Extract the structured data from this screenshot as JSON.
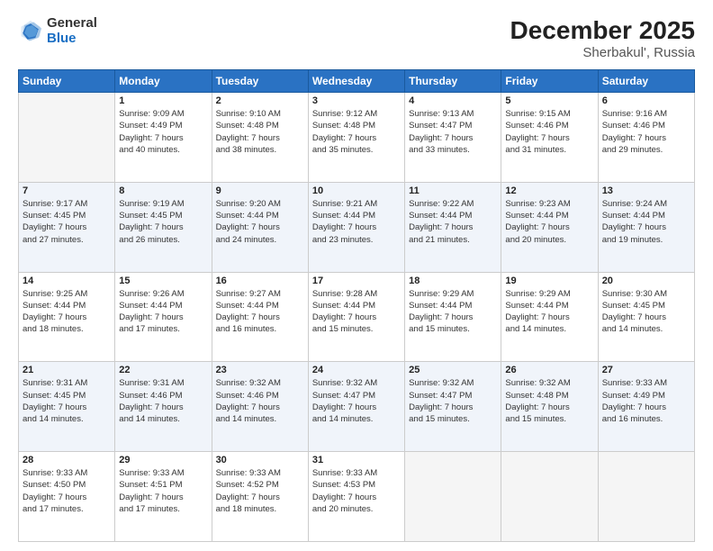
{
  "logo": {
    "general": "General",
    "blue": "Blue"
  },
  "title": {
    "month": "December 2025",
    "location": "Sherbakul', Russia"
  },
  "weekdays": [
    "Sunday",
    "Monday",
    "Tuesday",
    "Wednesday",
    "Thursday",
    "Friday",
    "Saturday"
  ],
  "weeks": [
    [
      {
        "day": "",
        "info": ""
      },
      {
        "day": "1",
        "info": "Sunrise: 9:09 AM\nSunset: 4:49 PM\nDaylight: 7 hours\nand 40 minutes."
      },
      {
        "day": "2",
        "info": "Sunrise: 9:10 AM\nSunset: 4:48 PM\nDaylight: 7 hours\nand 38 minutes."
      },
      {
        "day": "3",
        "info": "Sunrise: 9:12 AM\nSunset: 4:48 PM\nDaylight: 7 hours\nand 35 minutes."
      },
      {
        "day": "4",
        "info": "Sunrise: 9:13 AM\nSunset: 4:47 PM\nDaylight: 7 hours\nand 33 minutes."
      },
      {
        "day": "5",
        "info": "Sunrise: 9:15 AM\nSunset: 4:46 PM\nDaylight: 7 hours\nand 31 minutes."
      },
      {
        "day": "6",
        "info": "Sunrise: 9:16 AM\nSunset: 4:46 PM\nDaylight: 7 hours\nand 29 minutes."
      }
    ],
    [
      {
        "day": "7",
        "info": "Sunrise: 9:17 AM\nSunset: 4:45 PM\nDaylight: 7 hours\nand 27 minutes."
      },
      {
        "day": "8",
        "info": "Sunrise: 9:19 AM\nSunset: 4:45 PM\nDaylight: 7 hours\nand 26 minutes."
      },
      {
        "day": "9",
        "info": "Sunrise: 9:20 AM\nSunset: 4:44 PM\nDaylight: 7 hours\nand 24 minutes."
      },
      {
        "day": "10",
        "info": "Sunrise: 9:21 AM\nSunset: 4:44 PM\nDaylight: 7 hours\nand 23 minutes."
      },
      {
        "day": "11",
        "info": "Sunrise: 9:22 AM\nSunset: 4:44 PM\nDaylight: 7 hours\nand 21 minutes."
      },
      {
        "day": "12",
        "info": "Sunrise: 9:23 AM\nSunset: 4:44 PM\nDaylight: 7 hours\nand 20 minutes."
      },
      {
        "day": "13",
        "info": "Sunrise: 9:24 AM\nSunset: 4:44 PM\nDaylight: 7 hours\nand 19 minutes."
      }
    ],
    [
      {
        "day": "14",
        "info": "Sunrise: 9:25 AM\nSunset: 4:44 PM\nDaylight: 7 hours\nand 18 minutes."
      },
      {
        "day": "15",
        "info": "Sunrise: 9:26 AM\nSunset: 4:44 PM\nDaylight: 7 hours\nand 17 minutes."
      },
      {
        "day": "16",
        "info": "Sunrise: 9:27 AM\nSunset: 4:44 PM\nDaylight: 7 hours\nand 16 minutes."
      },
      {
        "day": "17",
        "info": "Sunrise: 9:28 AM\nSunset: 4:44 PM\nDaylight: 7 hours\nand 15 minutes."
      },
      {
        "day": "18",
        "info": "Sunrise: 9:29 AM\nSunset: 4:44 PM\nDaylight: 7 hours\nand 15 minutes."
      },
      {
        "day": "19",
        "info": "Sunrise: 9:29 AM\nSunset: 4:44 PM\nDaylight: 7 hours\nand 14 minutes."
      },
      {
        "day": "20",
        "info": "Sunrise: 9:30 AM\nSunset: 4:45 PM\nDaylight: 7 hours\nand 14 minutes."
      }
    ],
    [
      {
        "day": "21",
        "info": "Sunrise: 9:31 AM\nSunset: 4:45 PM\nDaylight: 7 hours\nand 14 minutes."
      },
      {
        "day": "22",
        "info": "Sunrise: 9:31 AM\nSunset: 4:46 PM\nDaylight: 7 hours\nand 14 minutes."
      },
      {
        "day": "23",
        "info": "Sunrise: 9:32 AM\nSunset: 4:46 PM\nDaylight: 7 hours\nand 14 minutes."
      },
      {
        "day": "24",
        "info": "Sunrise: 9:32 AM\nSunset: 4:47 PM\nDaylight: 7 hours\nand 14 minutes."
      },
      {
        "day": "25",
        "info": "Sunrise: 9:32 AM\nSunset: 4:47 PM\nDaylight: 7 hours\nand 15 minutes."
      },
      {
        "day": "26",
        "info": "Sunrise: 9:32 AM\nSunset: 4:48 PM\nDaylight: 7 hours\nand 15 minutes."
      },
      {
        "day": "27",
        "info": "Sunrise: 9:33 AM\nSunset: 4:49 PM\nDaylight: 7 hours\nand 16 minutes."
      }
    ],
    [
      {
        "day": "28",
        "info": "Sunrise: 9:33 AM\nSunset: 4:50 PM\nDaylight: 7 hours\nand 17 minutes."
      },
      {
        "day": "29",
        "info": "Sunrise: 9:33 AM\nSunset: 4:51 PM\nDaylight: 7 hours\nand 17 minutes."
      },
      {
        "day": "30",
        "info": "Sunrise: 9:33 AM\nSunset: 4:52 PM\nDaylight: 7 hours\nand 18 minutes."
      },
      {
        "day": "31",
        "info": "Sunrise: 9:33 AM\nSunset: 4:53 PM\nDaylight: 7 hours\nand 20 minutes."
      },
      {
        "day": "",
        "info": ""
      },
      {
        "day": "",
        "info": ""
      },
      {
        "day": "",
        "info": ""
      }
    ]
  ]
}
